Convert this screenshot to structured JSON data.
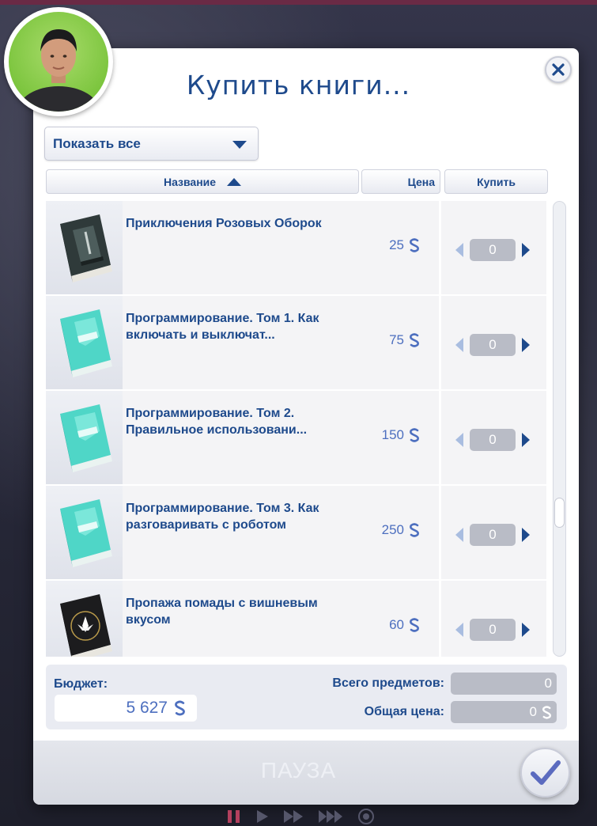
{
  "dialog": {
    "title": "Купить книги...",
    "filter_label": "Показать все"
  },
  "columns": {
    "name": "Название",
    "price": "Цена",
    "buy": "Купить"
  },
  "items": [
    {
      "name": "Приключения Розовых Оборок",
      "price": "25",
      "qty": "0",
      "cover": "dark"
    },
    {
      "name": "Программирование. Том 1. Как включать и выключат...",
      "price": "75",
      "qty": "0",
      "cover": "teal"
    },
    {
      "name": "Программирование. Том 2. Правильное использовани...",
      "price": "150",
      "qty": "0",
      "cover": "teal"
    },
    {
      "name": "Программирование. Том 3. Как разговаривать с роботом",
      "price": "250",
      "qty": "0",
      "cover": "teal"
    },
    {
      "name": "Пропажа помады с вишневым вкусом",
      "price": "60",
      "qty": "0",
      "cover": "black"
    }
  ],
  "footer": {
    "budget_label": "Бюджет:",
    "budget_value": "5 627",
    "total_items_label": "Всего предметов:",
    "total_items_value": "0",
    "total_price_label": "Общая цена:",
    "total_price_value": "0"
  },
  "bottom": {
    "pause_text": "ПАУЗА"
  },
  "colors": {
    "accent": "#1e4a8c",
    "price": "#4d6fbf",
    "qty_box": "#b9bcc6"
  },
  "icons": {
    "close": "close-icon",
    "dropdown": "triangle-down-icon",
    "sort": "triangle-up-icon",
    "currency": "simoleon-icon",
    "decrement": "arrow-left-icon",
    "increment": "arrow-right-icon",
    "confirm": "checkmark-icon"
  }
}
